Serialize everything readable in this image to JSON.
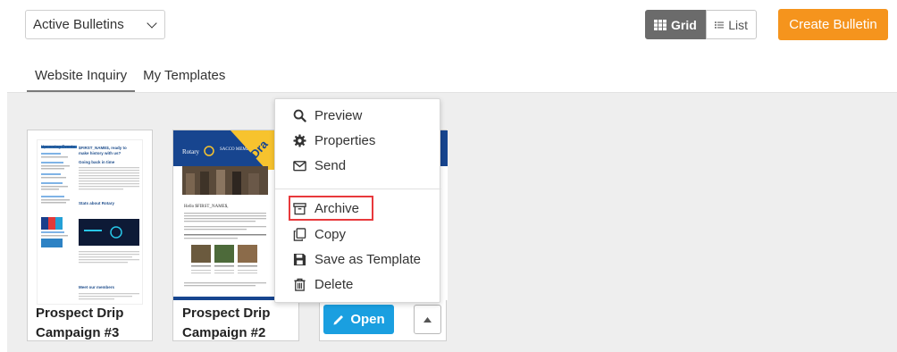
{
  "filter": {
    "selected": "Active Bulletins"
  },
  "view_toggle": {
    "grid_label": "Grid",
    "list_label": "List",
    "active": "grid"
  },
  "create_button": {
    "label": "Create Bulletin",
    "color": "#f5941d"
  },
  "tabs": [
    {
      "label": "Website Inquiry",
      "active": true
    },
    {
      "label": "My Templates",
      "active": false
    }
  ],
  "cards": [
    {
      "title_line1": "Prospect Drip",
      "title_line2": "Campaign #3"
    },
    {
      "title_line1": "Prospect Drip",
      "title_line2": "Campaign #2",
      "ribbon": "Dra"
    },
    {
      "open_label": "Open"
    }
  ],
  "thumb1": {
    "heading_left": "Upcoming Events",
    "heading_right": "$FIRST_NAME$, ready to make history with us?",
    "subhead_right": "Going back in time",
    "stats": "Stats about Rotary",
    "meet": "Meet our members"
  },
  "thumb2": {
    "logo": "Rotary",
    "header_text": "SACCO MEMBER",
    "hello": "Hello $FIRST_NAME$,"
  },
  "context_menu": {
    "items": [
      {
        "label": "Preview",
        "icon": "search-icon"
      },
      {
        "label": "Properties",
        "icon": "gear-icon"
      },
      {
        "label": "Send",
        "icon": "envelope-icon"
      },
      {
        "label": "Archive",
        "icon": "archive-icon",
        "highlighted": true
      },
      {
        "label": "Copy",
        "icon": "copy-icon"
      },
      {
        "label": "Save as Template",
        "icon": "save-icon"
      },
      {
        "label": "Delete",
        "icon": "trash-icon"
      }
    ],
    "highlight_color": "#e8393c"
  },
  "colors": {
    "accent_blue": "#1a9fe0",
    "rotary_blue": "#17458f",
    "ribbon_yellow": "#f7c32e"
  }
}
